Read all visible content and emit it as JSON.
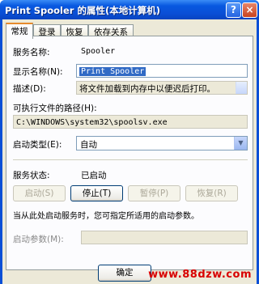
{
  "window": {
    "title": "Print Spooler 的属性(本地计算机)",
    "help_glyph": "?",
    "close_glyph": "×"
  },
  "tabs": [
    {
      "label": "常规",
      "active": true
    },
    {
      "label": "登录",
      "active": false
    },
    {
      "label": "恢复",
      "active": false
    },
    {
      "label": "依存关系",
      "active": false
    }
  ],
  "general": {
    "service_name_label": "服务名称:",
    "service_name_value": "Spooler",
    "display_name_label": "显示名称(N):",
    "display_name_value": "Print Spooler",
    "description_label": "描述(D):",
    "description_value": "将文件加载到内存中以便迟后打印。",
    "exe_path_label": "可执行文件的路径(H):",
    "exe_path_value": "C:\\WINDOWS\\system32\\spoolsv.exe",
    "startup_type_label": "启动类型(E):",
    "startup_type_value": "自动",
    "service_status_label": "服务状态:",
    "service_status_value": "已启动",
    "buttons": {
      "start": "启动(S)",
      "stop": "停止(T)",
      "pause": "暂停(P)",
      "resume": "恢复(R)"
    },
    "hint_text": "当从此处启动服务时，您可指定所适用的启动参数。",
    "start_params_label": "启动参数(M):",
    "start_params_value": ""
  },
  "footer": {
    "ok_label": "确定"
  },
  "watermark": "www.88dzw.com",
  "accent_colors": {
    "titlebar": "#0a4fd6",
    "selection": "#316ac5",
    "active_tab": "#e68b2c",
    "watermark": "#d80000"
  }
}
